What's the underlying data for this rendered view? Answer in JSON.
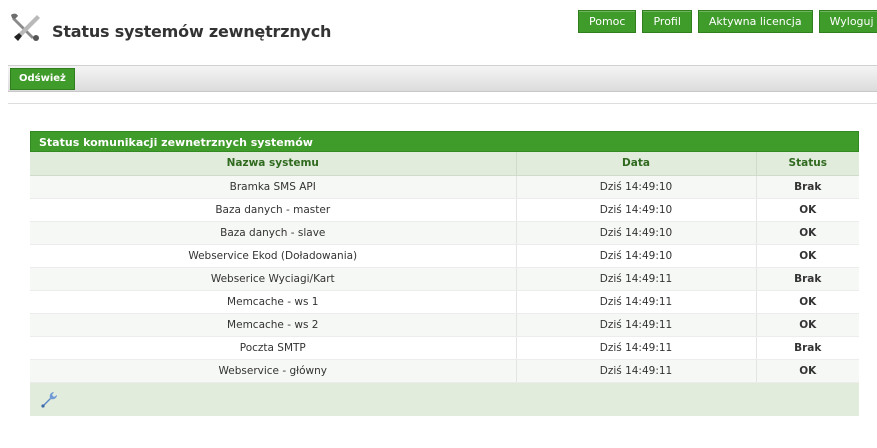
{
  "header": {
    "title": "Status systemów zewnętrznych",
    "icon": "tools-icon"
  },
  "nav": {
    "help": "Pomoc",
    "profile": "Profil",
    "license": "Aktywna licencja",
    "logout": "Wyloguj"
  },
  "toolbar": {
    "refresh_label": "Odśwież"
  },
  "status_box": {
    "title": "Status komunikacji zewnetrznych systemów",
    "columns": [
      "Nazwa systemu",
      "Data",
      "Status"
    ],
    "rows": [
      {
        "name": "Bramka SMS API",
        "date": "Dziś 14:49:10",
        "status": "Brak"
      },
      {
        "name": "Baza danych - master",
        "date": "Dziś 14:49:10",
        "status": "OK"
      },
      {
        "name": "Baza danych - slave",
        "date": "Dziś 14:49:10",
        "status": "OK"
      },
      {
        "name": "Webservice Ekod (Doładowania)",
        "date": "Dziś 14:49:10",
        "status": "OK"
      },
      {
        "name": "Webserice Wyciagi/Kart",
        "date": "Dziś 14:49:11",
        "status": "Brak"
      },
      {
        "name": "Memcache - ws 1",
        "date": "Dziś 14:49:11",
        "status": "OK"
      },
      {
        "name": "Memcache - ws 2",
        "date": "Dziś 14:49:11",
        "status": "OK"
      },
      {
        "name": "Poczta SMTP",
        "date": "Dziś 14:49:11",
        "status": "Brak"
      },
      {
        "name": "Webservice - główny",
        "date": "Dziś 14:49:11",
        "status": "OK"
      }
    ],
    "footer_icon": "wrench-icon"
  },
  "colors": {
    "accent_green": "#3f9b2a",
    "status_ok": "#2e8b1e",
    "status_missing": "#d01010"
  }
}
